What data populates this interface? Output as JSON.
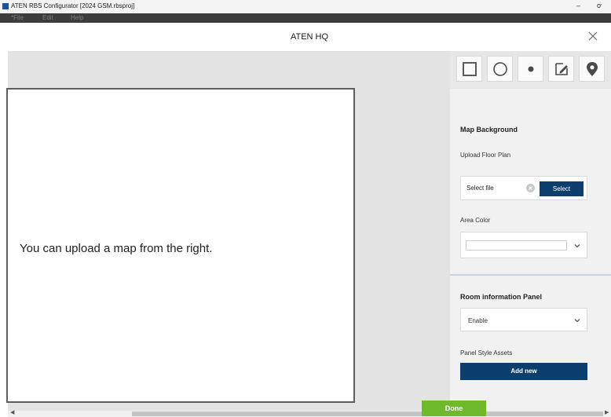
{
  "window": {
    "title": "ATEN RBS Configurator [2024 GSM.rbsproj]",
    "minimize_glyph": "–",
    "restore_glyph": "ơ"
  },
  "menu": {
    "items": [
      "*File",
      "Edit",
      "Help"
    ]
  },
  "dialog": {
    "title": "ATEN HQ",
    "close_icon": "close-icon"
  },
  "canvas": {
    "hint": "You can upload a map from the right."
  },
  "toolbar": {
    "tools": [
      {
        "name": "rectangle-tool",
        "icon": "square-icon"
      },
      {
        "name": "circle-tool",
        "icon": "circle-icon"
      },
      {
        "name": "point-tool",
        "icon": "dot-icon"
      },
      {
        "name": "edit-tool",
        "icon": "edit-icon"
      },
      {
        "name": "marker-tool",
        "icon": "map-pin-icon"
      }
    ]
  },
  "panel": {
    "map_background_title": "Map Background",
    "upload_label": "Upload Floor Plan",
    "file_placeholder": "Select file",
    "select_button": "Select",
    "area_color_label": "Area Color",
    "area_color_value": "",
    "room_panel_title": "Room information Panel",
    "room_panel_value": "Enable",
    "panel_style_label": "Panel Style Assets",
    "add_new_button": "Add new"
  },
  "footer": {
    "done_button": "Done"
  },
  "colors": {
    "primary": "#0d3f6e",
    "done": "#6fba2c",
    "menubar": "#3c3c3c"
  }
}
